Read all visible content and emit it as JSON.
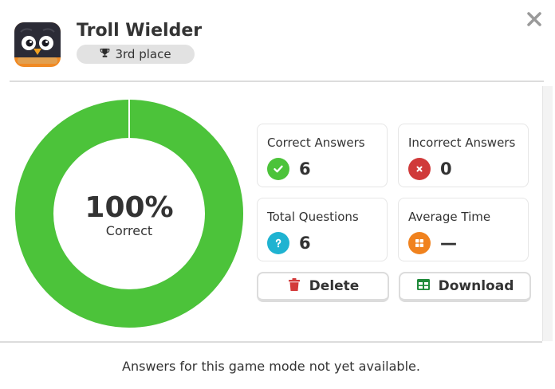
{
  "player": {
    "name": "Troll Wielder",
    "place": "3rd place"
  },
  "summary": {
    "percent_label": "100%",
    "caption": "Correct",
    "correct_fraction": 1.0
  },
  "stats": {
    "correct": {
      "label": "Correct Answers",
      "value": "6"
    },
    "incorrect": {
      "label": "Incorrect Answers",
      "value": "0"
    },
    "total": {
      "label": "Total Questions",
      "value": "6"
    },
    "avg_time": {
      "label": "Average Time",
      "value": "—"
    }
  },
  "actions": {
    "delete_label": "Delete",
    "download_label": "Download"
  },
  "footer": {
    "message": "Answers for this game mode not yet available."
  },
  "colors": {
    "correct_green": "#4cc33a",
    "incorrect_red": "#d03a3a",
    "total_teal": "#1fb3d1",
    "time_orange": "#f0821e",
    "delete_red": "#d33b3b",
    "download_green": "#1f8a3a"
  },
  "icons": {
    "close": "close-icon",
    "trophy": "trophy-icon",
    "check": "check-icon",
    "x": "x-icon",
    "question": "question-icon",
    "grid": "grid-icon",
    "trash": "trash-icon",
    "table": "table-icon"
  }
}
